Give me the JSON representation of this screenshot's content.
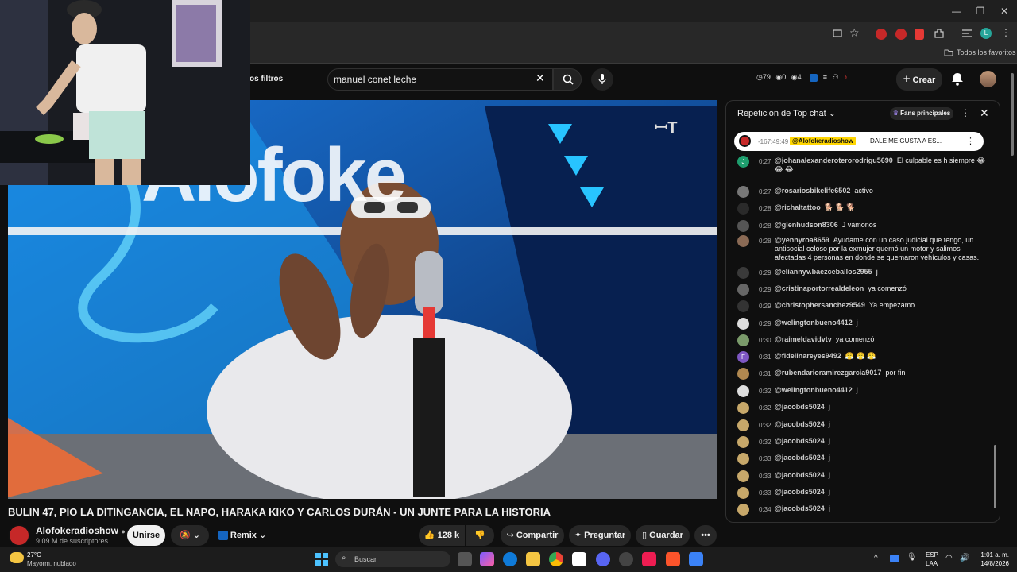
{
  "bookmarks": {
    "all_bookmarks": "Todos los favoritos"
  },
  "header": {
    "filters": "os filtros",
    "search_value": "manuel conet leche",
    "stats": [
      {
        "icon": "clock-icon",
        "value": "79"
      },
      {
        "icon": "eye-icon",
        "value": "0"
      },
      {
        "icon": "eye-icon",
        "value": "4"
      }
    ],
    "create_label": "Crear"
  },
  "video": {
    "logo_text": "Alofoke",
    "title": "BULIN 47, PIO LA DITINGANCIA, EL NAPO, HARAKA KIKO Y CARLOS DURÁN - UN JUNTE PARA LA HISTORIA"
  },
  "channel": {
    "name": "Alofokeradioshow",
    "subscribers": "9.09 M de suscriptores",
    "join_label": "Unirse",
    "remix_label": "Remix",
    "like_count": "128 k",
    "share_label": "Compartir",
    "ask_label": "Preguntar",
    "save_label": "Guardar"
  },
  "chat": {
    "title": "Repetición de Top chat",
    "fans_label": "Fans principales",
    "pinned": {
      "time": "-167:49:49",
      "author": "@Alofokeradioshow",
      "text": "DALE ME GUSTA A ES..."
    },
    "messages": [
      {
        "time": "0:27",
        "author": "@johanalexanderoterorodrigu5690",
        "text": "El culpable es h siempre 😂 😂 😂",
        "avatar": "#1e9e6e",
        "letter": "J"
      },
      {
        "time": "0:27",
        "author": "@rosariosbikelife6502",
        "text": "activo",
        "avatar": "#777777",
        "letter": ""
      },
      {
        "time": "0:28",
        "author": "@richaltattoo",
        "text": "🐕 🐕 🐕",
        "avatar": "#2a2a2a",
        "letter": ""
      },
      {
        "time": "0:28",
        "author": "@glenhudson8306",
        "text": "J vámonos",
        "avatar": "#555555",
        "letter": ""
      },
      {
        "time": "0:28",
        "author": "@yennyroa8659",
        "text": "Ayudame con un caso judicial que tengo, un antisocial celoso por la exmujer quemó un motor y salimos afectadas 4 personas en donde se quemaron vehículos y casas.",
        "avatar": "#8a6a55",
        "letter": ""
      },
      {
        "time": "0:29",
        "author": "@eliannyv.baezceballos2955",
        "text": "j",
        "avatar": "#3a3a3a",
        "letter": ""
      },
      {
        "time": "0:29",
        "author": "@cristinaportorrealdeleon",
        "text": "ya comenzó",
        "avatar": "#666666",
        "letter": ""
      },
      {
        "time": "0:29",
        "author": "@christophersanchez9549",
        "text": "Ya empezamo",
        "avatar": "#333333",
        "letter": ""
      },
      {
        "time": "0:29",
        "author": "@welingtonbueno4412",
        "text": "j",
        "avatar": "#dddddd",
        "letter": ""
      },
      {
        "time": "0:30",
        "author": "@raimeldavidvtv",
        "text": "ya comenzó",
        "avatar": "#7a9a6a",
        "letter": ""
      },
      {
        "time": "0:31",
        "author": "@fidelinareyes9492",
        "text": "😤 😤 😤",
        "avatar": "#7e57c2",
        "letter": "F"
      },
      {
        "time": "0:31",
        "author": "@rubendarioramirezgarcia9017",
        "text": "por fin",
        "avatar": "#b08850",
        "letter": ""
      },
      {
        "time": "0:32",
        "author": "@welingtonbueno4412",
        "text": "j",
        "avatar": "#dddddd",
        "letter": ""
      },
      {
        "time": "0:32",
        "author": "@jacobds5024",
        "text": "j",
        "avatar": "#c7a86a",
        "letter": ""
      },
      {
        "time": "0:32",
        "author": "@jacobds5024",
        "text": "j",
        "avatar": "#c7a86a",
        "letter": ""
      },
      {
        "time": "0:32",
        "author": "@jacobds5024",
        "text": "j",
        "avatar": "#c7a86a",
        "letter": ""
      },
      {
        "time": "0:33",
        "author": "@jacobds5024",
        "text": "j",
        "avatar": "#c7a86a",
        "letter": ""
      },
      {
        "time": "0:33",
        "author": "@jacobds5024",
        "text": "j",
        "avatar": "#c7a86a",
        "letter": ""
      },
      {
        "time": "0:33",
        "author": "@jacobds5024",
        "text": "j",
        "avatar": "#c7a86a",
        "letter": ""
      },
      {
        "time": "0:34",
        "author": "@jacobds5024",
        "text": "j",
        "avatar": "#c7a86a",
        "letter": ""
      }
    ]
  },
  "taskbar": {
    "temperature": "27°C",
    "weather": "Mayorm. nublado",
    "search_label": "Buscar",
    "language": "ESP",
    "layout": "LAA",
    "time": "1:01 a. m.",
    "date": "14/8/2026"
  },
  "colors": {
    "accent_red": "#ff0000",
    "background": "#0f0f0f",
    "video_blue": "#1a74d6"
  }
}
